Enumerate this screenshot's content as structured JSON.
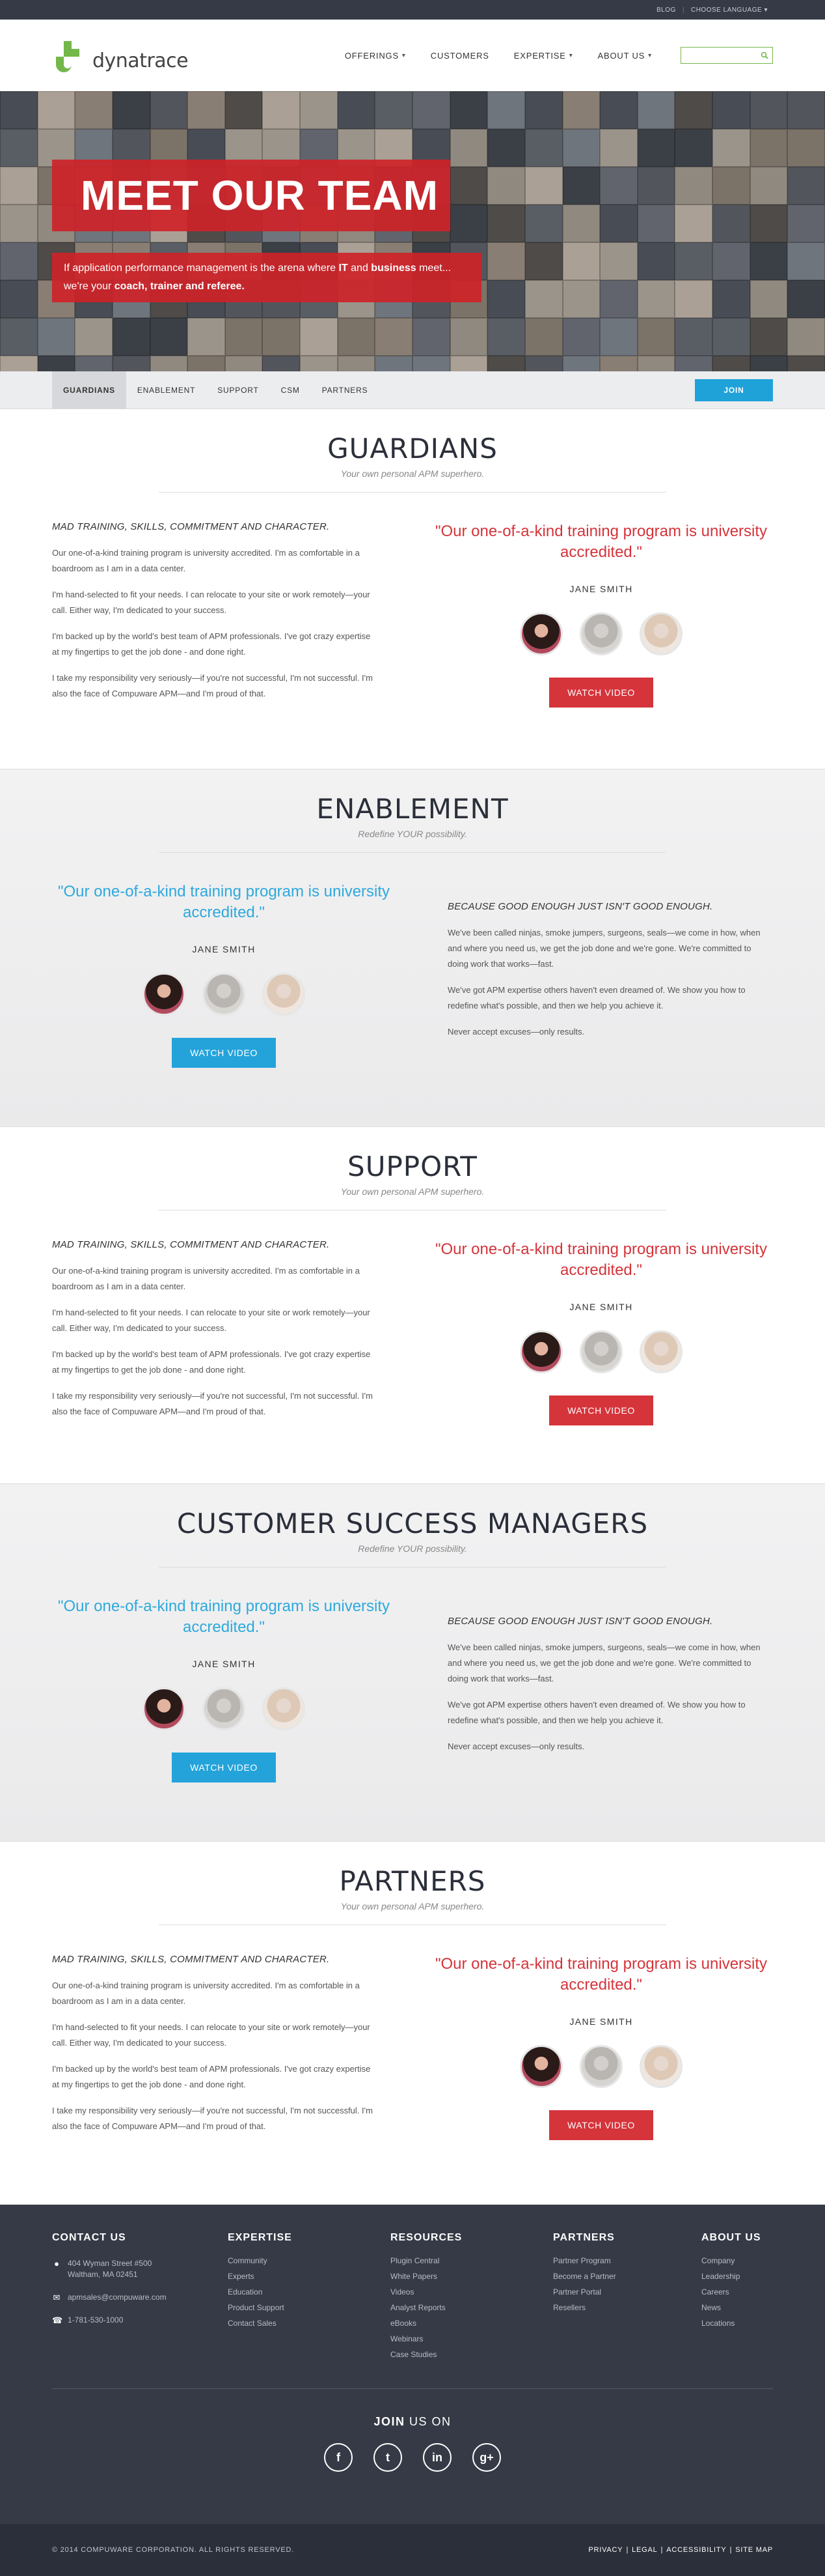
{
  "topbar": {
    "blog": "BLOG",
    "separator": "|",
    "language": "CHOOSE LANGUAGE"
  },
  "brand": {
    "name": "dynatrace",
    "accent": "#74b74a"
  },
  "nav": {
    "items": [
      {
        "label": "OFFERINGS",
        "dropdown": true
      },
      {
        "label": "CUSTOMERS",
        "dropdown": false
      },
      {
        "label": "EXPERTISE",
        "dropdown": true
      },
      {
        "label": "ABOUT US",
        "dropdown": true
      }
    ],
    "search_icon": "search-icon"
  },
  "hero": {
    "title": "MEET OUR TEAM",
    "sub_1": "If application performance management is the arena where",
    "sub_it": "IT",
    "sub_and": "and",
    "sub_business": "business",
    "sub_2": "meet...",
    "sub_3": "we're your",
    "sub_roles": "coach, trainer and referee."
  },
  "subnav": {
    "items": [
      "GUARDIANS",
      "ENABLEMENT",
      "SUPPORT",
      "CSM",
      "PARTNERS"
    ],
    "active": "GUARDIANS",
    "join": "JOIN"
  },
  "sections": [
    {
      "title": "GUARDIANS",
      "subtitle": "Your own personal APM superhero.",
      "lead": "MAD TRAINING, SKILLS, COMMITMENT AND CHARACTER.",
      "paras": [
        "Our one-of-a-kind training program is university accredited. I'm as comfortable in a boardroom as I am in a data center.",
        "I'm hand-selected to fit your needs. I can relocate to your site or work remotely—your call. Either way, I'm dedicated to your success.",
        "I'm backed up by the world's best team of APM professionals. I've got crazy expertise at my fingertips to get the job done - and done right.",
        "I take my responsibility very seriously—if you're not successful, I'm not successful. I'm also the face of Compuware APM—and I'm proud of that."
      ],
      "quote": "\"Our one-of-a-kind training program is university accredited.\"",
      "person": "JANE SMITH",
      "button": "WATCH VIDEO"
    },
    {
      "title": "ENABLEMENT",
      "subtitle": "Redefine YOUR possibility.",
      "lead": "BECAUSE GOOD ENOUGH JUST ISN'T GOOD ENOUGH.",
      "paras": [
        "We've been called ninjas, smoke jumpers, surgeons, seals—we come in how, when and where you need us, we get the job done and we're gone. We're committed to doing work that works—fast.",
        "We've got APM expertise others haven't even dreamed of. We show you how to redefine what's possible, and then we help you achieve it.",
        "Never accept excuses—only results."
      ],
      "quote": "\"Our one-of-a-kind training program is university accredited.\"",
      "person": "JANE SMITH",
      "button": "WATCH VIDEO"
    },
    {
      "title": "SUPPORT",
      "subtitle": "Your own personal APM superhero.",
      "lead": "MAD TRAINING, SKILLS, COMMITMENT AND CHARACTER.",
      "paras": [
        "Our one-of-a-kind training program is university accredited. I'm as comfortable in a boardroom as I am in a data center.",
        "I'm hand-selected to fit your needs. I can relocate to your site or work remotely—your call. Either way, I'm dedicated to your success.",
        "I'm backed up by the world's best team of APM professionals. I've got crazy expertise at my fingertips to get the job done - and done right.",
        "I take my responsibility very seriously—if you're not successful, I'm not successful. I'm also the face of Compuware APM—and I'm proud of that."
      ],
      "quote": "\"Our one-of-a-kind training program is university accredited.\"",
      "person": "JANE SMITH",
      "button": "WATCH VIDEO"
    },
    {
      "title": "CUSTOMER SUCCESS MANAGERS",
      "subtitle": "Redefine YOUR possibility.",
      "lead": "BECAUSE GOOD ENOUGH JUST ISN'T GOOD ENOUGH.",
      "paras": [
        "We've been called ninjas, smoke jumpers, surgeons, seals—we come in how, when and where you need us, we get the job done and we're gone. We're committed to doing work that works—fast.",
        "We've got APM expertise others haven't even dreamed of. We show you how to redefine what's possible, and then we help you achieve it.",
        "Never accept excuses—only results."
      ],
      "quote": "\"Our one-of-a-kind training program is university accredited.\"",
      "person": "JANE SMITH",
      "button": "WATCH VIDEO"
    },
    {
      "title": "PARTNERS",
      "subtitle": "Your own personal APM superhero.",
      "lead": "MAD TRAINING, SKILLS, COMMITMENT AND CHARACTER.",
      "paras": [
        "Our one-of-a-kind training program is university accredited. I'm as comfortable in a boardroom as I am in a data center.",
        "I'm hand-selected to fit your needs. I can relocate to your site or work remotely—your call. Either way, I'm dedicated to your success.",
        "I'm backed up by the world's best team of APM professionals. I've got crazy expertise at my fingertips to get the job done - and done right.",
        "I take my responsibility very seriously—if you're not successful, I'm not successful. I'm also the face of Compuware APM—and I'm proud of that."
      ],
      "quote": "\"Our one-of-a-kind training program is university accredited.\"",
      "person": "JANE SMITH",
      "button": "WATCH VIDEO"
    }
  ],
  "footer": {
    "contact": {
      "title": "CONTACT US",
      "address_1": "404 Wyman Street #500",
      "address_2": "Waltham, MA 02451",
      "email": "apmsales@compuware.com",
      "phone": "1-781-530-1000"
    },
    "expertise": {
      "title": "EXPERTISE",
      "links": [
        "Community",
        "Experts",
        "Education",
        "Product Support",
        "Contact Sales"
      ]
    },
    "resources": {
      "title": "RESOURCES",
      "links": [
        "Plugin Central",
        "White Papers",
        "Videos",
        "Analyst Reports",
        "eBooks",
        "Webinars",
        "Case Studies"
      ]
    },
    "partners": {
      "title": "PARTNERS",
      "links": [
        "Partner Program",
        "Become a Partner",
        "Partner Portal",
        "Resellers"
      ]
    },
    "about": {
      "title": "ABOUT US",
      "links": [
        "Company",
        "Leadership",
        "Careers",
        "News",
        "Locations"
      ]
    },
    "join_bold": "JOIN",
    "join_rest": "US ON",
    "socials": [
      "facebook-icon",
      "twitter-icon",
      "linkedin-icon",
      "google-plus-icon"
    ],
    "copyright": "© 2014 COMPUWARE CORPORATION. ALL RIGHTS RESERVED.",
    "legal": [
      "PRIVACY",
      "LEGAL",
      "ACCESSIBILITY",
      "SITE MAP"
    ]
  },
  "colors": {
    "red": "#d5343b",
    "blue": "#24a3da",
    "dark": "#353a46",
    "green": "#74b74a"
  }
}
